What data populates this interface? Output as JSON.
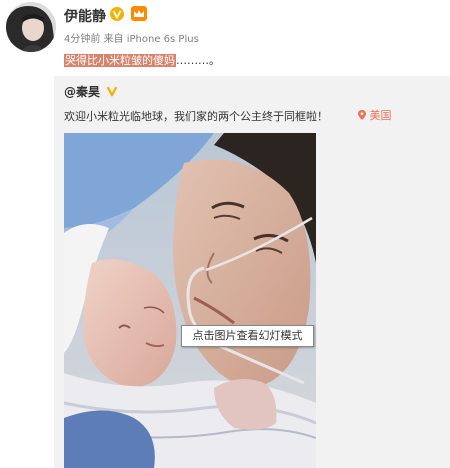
{
  "post": {
    "author": "伊能静",
    "time": "4分钟前",
    "source_prefix": "来自",
    "source": "iPhone 6s Plus",
    "text_highlighted": "哭得比小米粒皱的傻妈",
    "text_suffix": "………。"
  },
  "repost": {
    "author": "@秦昊",
    "text": "欢迎小米粒光临地球，我们家的两个公主终于同框啦！",
    "location": "美国"
  },
  "tooltip": {
    "text": "点击图片查看幻灯模式"
  },
  "colors": {
    "verified": "#f5b200",
    "highlight": "#d8836c",
    "location": "#eb7350",
    "repost_bg": "#f2f2f2"
  },
  "icons": {
    "verified": "verified-v-icon",
    "member": "member-crown-icon",
    "location": "location-pin-icon"
  }
}
